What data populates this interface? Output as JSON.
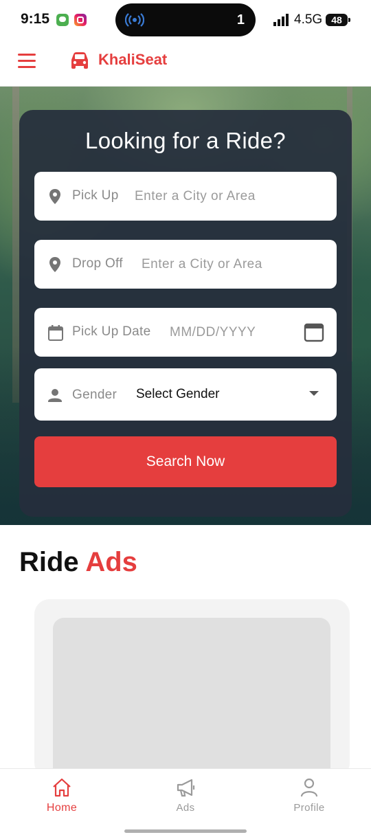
{
  "status_bar": {
    "time": "9:15",
    "island_count": "1",
    "network": "4.5G",
    "battery": "48"
  },
  "header": {
    "brand": "KhaliSeat",
    "accent_color": "#e53e3e"
  },
  "search_card": {
    "title": "Looking for a Ride?",
    "pickup": {
      "label": "Pick Up",
      "placeholder": "Enter a City or Area",
      "value": ""
    },
    "dropoff": {
      "label": "Drop Off",
      "placeholder": "Enter a City or Area",
      "value": ""
    },
    "date": {
      "label": "Pick Up Date",
      "placeholder": "MM/DD/YYYY",
      "value": ""
    },
    "gender": {
      "label": "Gender",
      "selected": "Select Gender"
    },
    "search_button": "Search Now"
  },
  "ads": {
    "heading_part1": "Ride",
    "heading_part2": "Ads"
  },
  "bottom_nav": {
    "items": [
      {
        "label": "Home",
        "icon": "home-icon",
        "active": true
      },
      {
        "label": "Ads",
        "icon": "megaphone-icon",
        "active": false
      },
      {
        "label": "Profile",
        "icon": "user-icon",
        "active": false
      }
    ]
  }
}
